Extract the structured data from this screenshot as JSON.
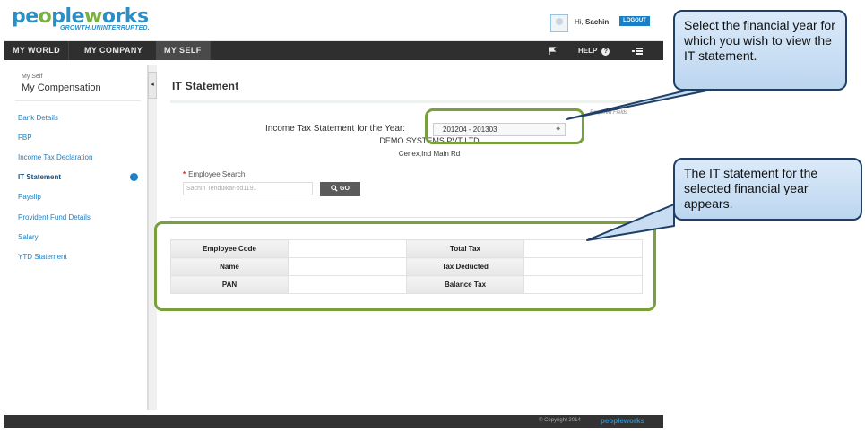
{
  "app": {
    "logo_text_a": "pe",
    "logo_text_b": "o",
    "logo_text_c": "ple",
    "logo_text_d": "w",
    "logo_text_e": "orks",
    "tagline": "GROWTH.UNINTERRUPTED."
  },
  "user": {
    "greeting_prefix": "Hi,",
    "name": "Sachin",
    "logout_label": "LOGOUT"
  },
  "nav": {
    "tabs": [
      {
        "label": "MY WORLD"
      },
      {
        "label": "MY COMPANY"
      },
      {
        "label": "MY SELF"
      }
    ],
    "help_label": "HELP",
    "flag_icon": "flag-icon",
    "help_icon": "question-icon",
    "menu_icon": "list-menu-icon"
  },
  "sidebar": {
    "breadcrumb": "My Self",
    "title": "My Compensation",
    "items": [
      {
        "label": "Bank Details"
      },
      {
        "label": "FBP"
      },
      {
        "label": "Income Tax Declaration"
      },
      {
        "label": "IT Statement"
      },
      {
        "label": "Payslip"
      },
      {
        "label": "Provident Fund Details"
      },
      {
        "label": "Salary"
      },
      {
        "label": "YTD Statement"
      }
    ],
    "collapse_glyph": "◂"
  },
  "main": {
    "title": "IT Statement",
    "required_note": "Required Fields",
    "year_label": "Income Tax Statement for the Year:",
    "year_value": "201204 - 201303",
    "company": "DEMO SYSTEMS PVT LTD",
    "address": "Cenex,Ind Main Rd",
    "employee_search_label": "Employee Search",
    "employee_search_value": "Sachin Tendulkar-xd1191",
    "go_label": "GO"
  },
  "table": {
    "rows": [
      {
        "left_label": "Employee Code",
        "left_value": "",
        "right_label": "Total Tax",
        "right_value": ""
      },
      {
        "left_label": "Name",
        "left_value": "",
        "right_label": "Tax Deducted",
        "right_value": ""
      },
      {
        "left_label": "PAN",
        "left_value": "",
        "right_label": "Balance Tax",
        "right_value": ""
      }
    ]
  },
  "callouts": {
    "year_hint": "Select the financial year for which you wish to view the IT statement.",
    "table_hint": "The IT  statement for the selected financial year appears."
  },
  "footer": {
    "copyright": "© Copyright 2014",
    "logo": "peopleworks"
  },
  "colors": {
    "brand_blue": "#2a8fc7",
    "brand_green": "#78b13f",
    "highlight_green": "#78a03c",
    "nav_dark": "#2f2f2f"
  }
}
